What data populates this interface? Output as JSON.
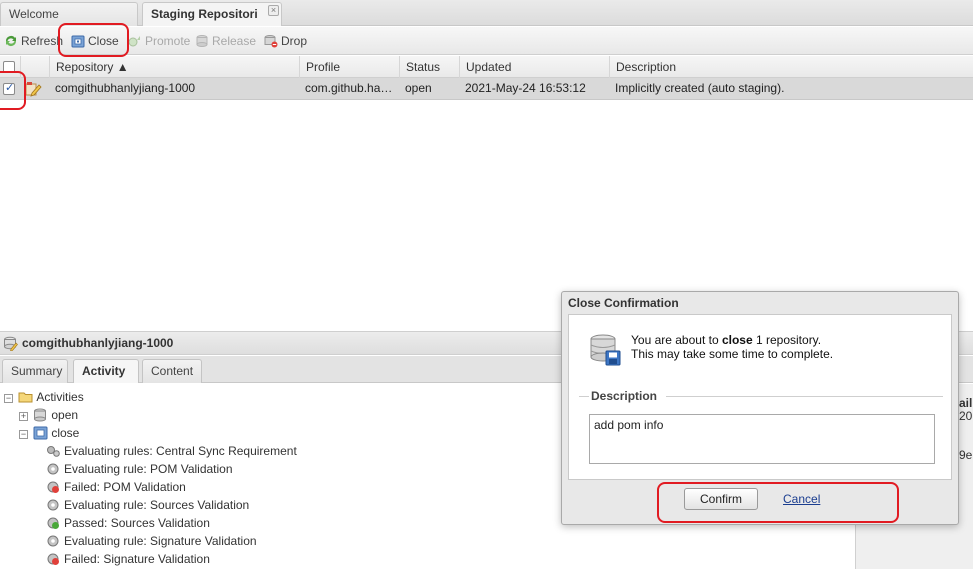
{
  "tabs": [
    {
      "label": "Welcome"
    },
    {
      "label": "Staging Repositori"
    }
  ],
  "toolbar": {
    "refresh": "Refresh",
    "close": "Close",
    "promote": "Promote",
    "release": "Release",
    "drop": "Drop"
  },
  "grid": {
    "columns": [
      "Repository ▲",
      "Profile",
      "Status",
      "Updated",
      "Description"
    ],
    "rows": [
      {
        "repository": "comgithubhanlyjiang-1000",
        "profile": "com.github.ha…",
        "status": "open",
        "updated": "2021-May-24 16:53:12",
        "description": "Implicitly created (auto staging).",
        "selected": true
      }
    ]
  },
  "detail": {
    "title": "comgithubhanlyjiang-1000",
    "tabs": [
      "Summary",
      "Activity",
      "Content"
    ],
    "active_tab": "Activity",
    "tree": {
      "root": "Activities",
      "nodes": [
        "open",
        "close"
      ],
      "events": [
        "Evaluating rules: Central Sync Requirement",
        "Evaluating rule: POM Validation",
        "Failed: POM Validation",
        "Evaluating rule: Sources Validation",
        "Passed: Sources Validation",
        "Evaluating rule: Signature Validation",
        "Failed: Signature Validation"
      ]
    },
    "right_fragments": [
      "ail",
      "20",
      "9e"
    ]
  },
  "dialog": {
    "title": "Close Confirmation",
    "message_prefix": "You are about to ",
    "message_bold": "close",
    "message_suffix": " 1 repository.",
    "message_line2": "This may take some time to complete.",
    "description_label": "Description",
    "description_value": "add pom info",
    "confirm_label": "Confirm",
    "cancel_label": "Cancel"
  },
  "colors": {
    "highlight": "#e11b22",
    "selected_row": "#d9d9d9",
    "link": "#1a3d8f"
  }
}
